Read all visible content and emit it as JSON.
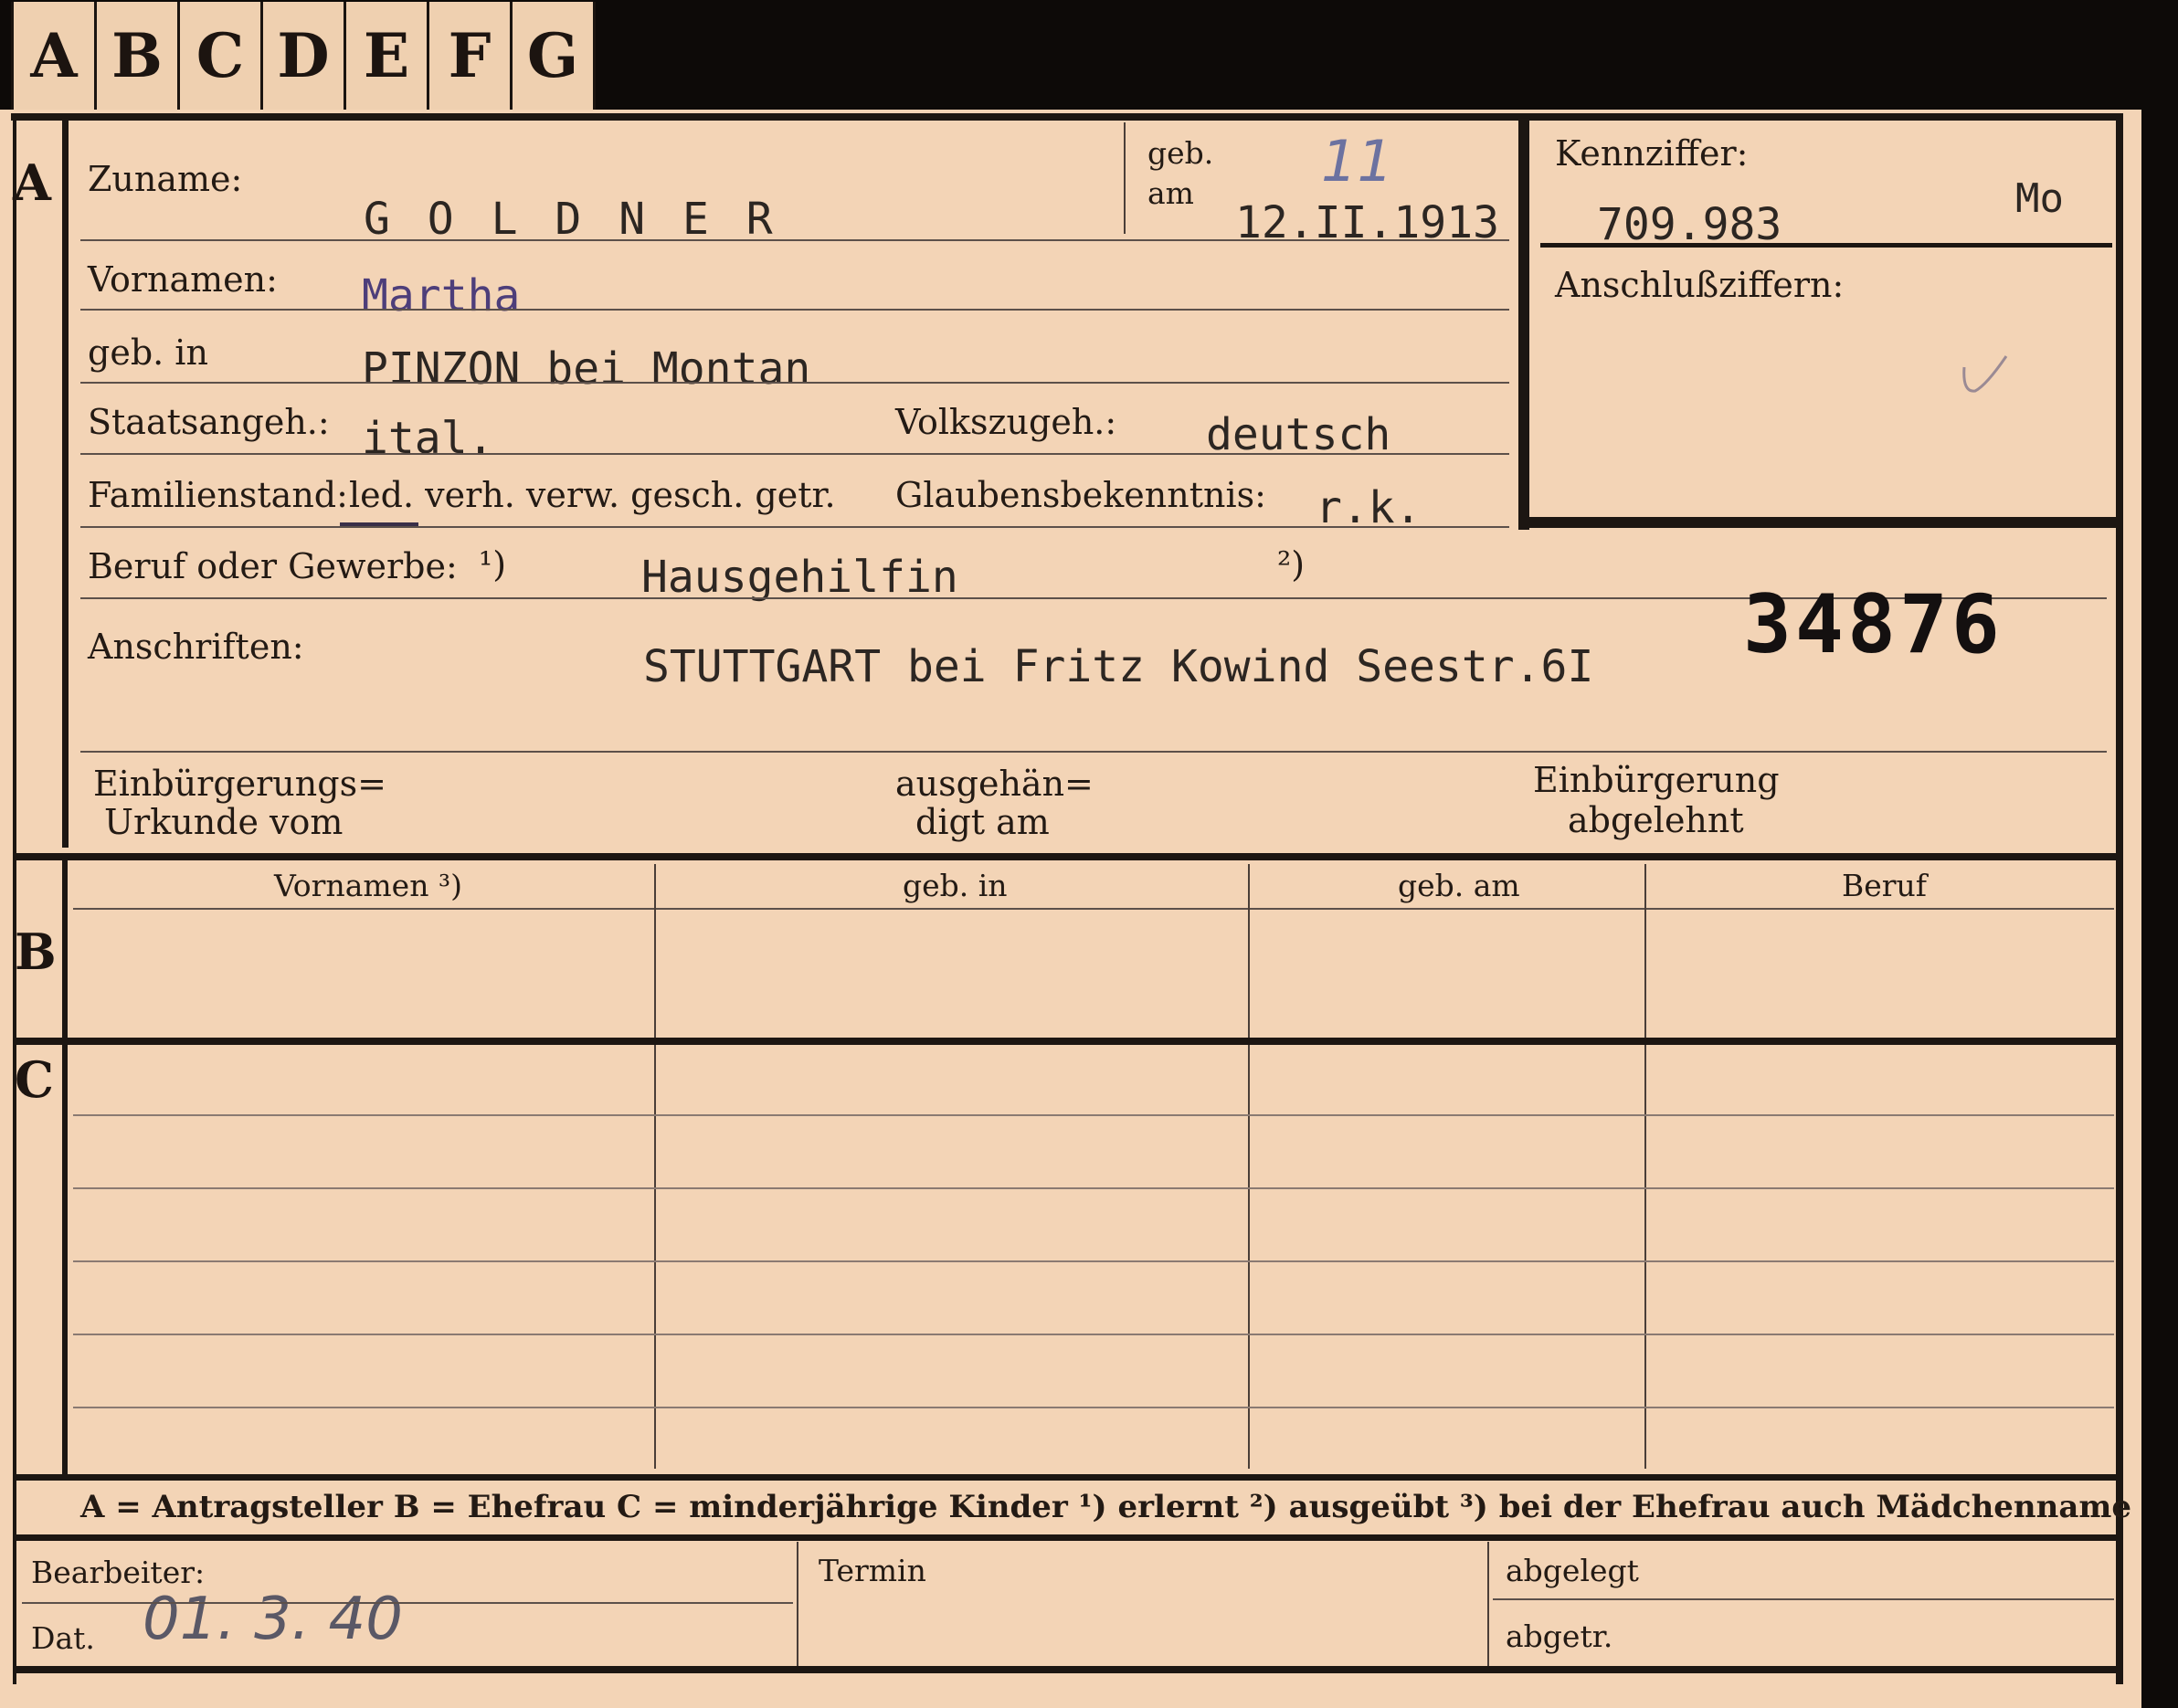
{
  "tabs": [
    "A",
    "B",
    "C",
    "D",
    "E",
    "F",
    "G"
  ],
  "sections": {
    "a": "A",
    "b": "B",
    "c": "C"
  },
  "labels": {
    "zuname": "Zuname:",
    "geb": "geb.",
    "am": "am",
    "kennziffer": "Kennziffer:",
    "anschlussziffern": "Anschlußziffern:",
    "vornamen": "Vornamen:",
    "geb_in": "geb. in",
    "staatsangeh": "Staatsangeh.:",
    "volkszugeh": "Volkszugeh.:",
    "familienstand": "Familienstand:",
    "familienstand_options": "led. verh. verw. gesch. getr.",
    "glaubensbekenntnis": "Glaubensbekenntnis:",
    "beruf_gewerbe": "Beruf oder Gewerbe:",
    "fn1": "¹)",
    "fn2": "²)",
    "anschriften": "Anschriften:",
    "einbuergerung_urkunde_1": "Einbürgerungs=",
    "einbuergerung_urkunde_2": "Urkunde vom",
    "ausgehaendigt_1": "ausgehän=",
    "ausgehaendigt_2": "digt am",
    "einbuergerung_abgelehnt_1": "Einbürgerung",
    "einbuergerung_abgelehnt_2": "abgelehnt"
  },
  "values": {
    "zuname": "G O L D N E R",
    "geb_am": "12.II.1913",
    "geb_am_note": "11",
    "kennziffer": "709.983",
    "kennziffer_suffix": "Mo",
    "vornamen": "Martha",
    "geb_in": "PINZON bei Montan",
    "staatsangeh": "ital.",
    "volkszugeh": "deutsch",
    "glaubensbekenntnis": "r.k.",
    "beruf": "Hausgehilfin",
    "anschrift": "STUTTGART bei Fritz Kowind Seestr.6I",
    "big_number": "34876"
  },
  "table": {
    "headers": [
      "Vornamen ³)",
      "geb. in",
      "geb. am",
      "Beruf"
    ]
  },
  "legend": "A = Antragsteller   B = Ehefrau   C = minderjährige Kinder   ¹) erlernt   ²) ausgeübt   ³) bei der Ehefrau auch Mädchenname",
  "footer": {
    "bearbeiter": "Bearbeiter:",
    "dat": "Dat.",
    "dat_value": "01. 3. 40",
    "termin": "Termin",
    "abgelegt": "abgelegt",
    "abgetr": "abgetr."
  }
}
